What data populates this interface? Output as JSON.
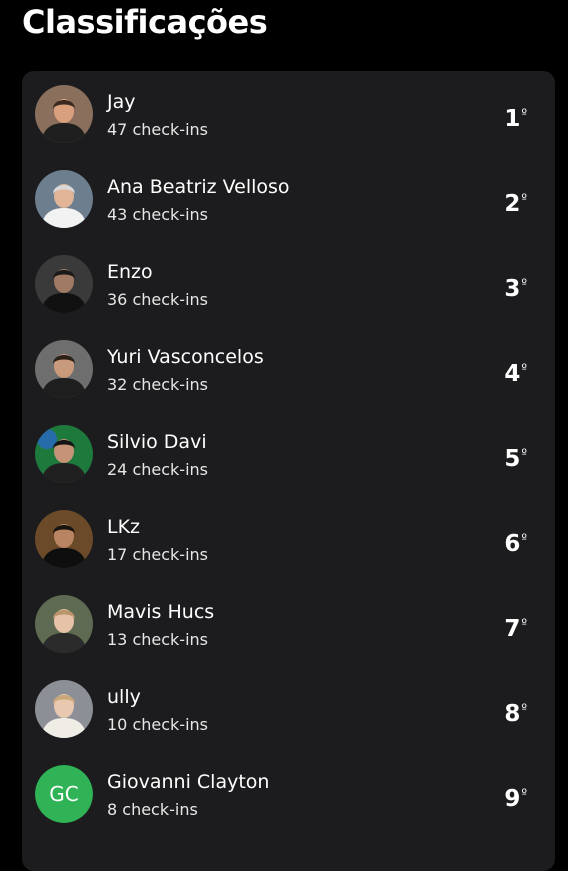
{
  "header": {
    "title": "Classificações"
  },
  "leaderboard": {
    "items": [
      {
        "name": "Jay",
        "checkins": "47 check-ins",
        "rank": "1",
        "rank_suffix": "º",
        "avatar": {
          "type": "photo",
          "bg": "#8a6f5c",
          "skin": "#d9a07e",
          "hair": "#3a2a1e",
          "shirt": "#1f1f1f"
        }
      },
      {
        "name": "Ana Beatriz Velloso",
        "checkins": "43 check-ins",
        "rank": "2",
        "rank_suffix": "º",
        "avatar": {
          "type": "photo",
          "bg": "#6d7f8e",
          "skin": "#e0b494",
          "hair": "#d8d8d8",
          "shirt": "#f2f2f2"
        }
      },
      {
        "name": "Enzo",
        "checkins": "36 check-ins",
        "rank": "3",
        "rank_suffix": "º",
        "avatar": {
          "type": "photo",
          "bg": "#3a3a3a",
          "skin": "#a07a62",
          "hair": "#1a1a1a",
          "shirt": "#111111"
        }
      },
      {
        "name": "Yuri Vasconcelos",
        "checkins": "32 check-ins",
        "rank": "4",
        "rank_suffix": "º",
        "avatar": {
          "type": "photo",
          "bg": "#6e6e6e",
          "skin": "#c99a7c",
          "hair": "#2a2018",
          "shirt": "#1e1e1e"
        }
      },
      {
        "name": "Silvio Davi",
        "checkins": "24 check-ins",
        "rank": "5",
        "rank_suffix": "º",
        "avatar": {
          "type": "photo",
          "bg": "#1e7a3c",
          "skin": "#c59476",
          "hair": "#151515",
          "shirt": "#202020",
          "accent": "#2a66d9"
        }
      },
      {
        "name": "LKz",
        "checkins": "17 check-ins",
        "rank": "6",
        "rank_suffix": "º",
        "avatar": {
          "type": "photo",
          "bg": "#6a4a28",
          "skin": "#b88462",
          "hair": "#1a1410",
          "shirt": "#0e0e0e"
        }
      },
      {
        "name": "Mavis Hucs",
        "checkins": "13 check-ins",
        "rank": "7",
        "rank_suffix": "º",
        "avatar": {
          "type": "photo",
          "bg": "#5f6a52",
          "skin": "#e6c2a8",
          "hair": "#b8956a",
          "shirt": "#2b2b2b"
        }
      },
      {
        "name": "ully",
        "checkins": "10 check-ins",
        "rank": "8",
        "rank_suffix": "º",
        "avatar": {
          "type": "photo",
          "bg": "#8c8f96",
          "skin": "#e8c8ae",
          "hair": "#c9a77a",
          "shirt": "#f0ece6"
        }
      },
      {
        "name": "Giovanni Clayton",
        "checkins": "8 check-ins",
        "rank": "9",
        "rank_suffix": "º",
        "avatar": {
          "type": "initials",
          "initials": "GC",
          "bg": "#2fb356"
        }
      }
    ]
  }
}
